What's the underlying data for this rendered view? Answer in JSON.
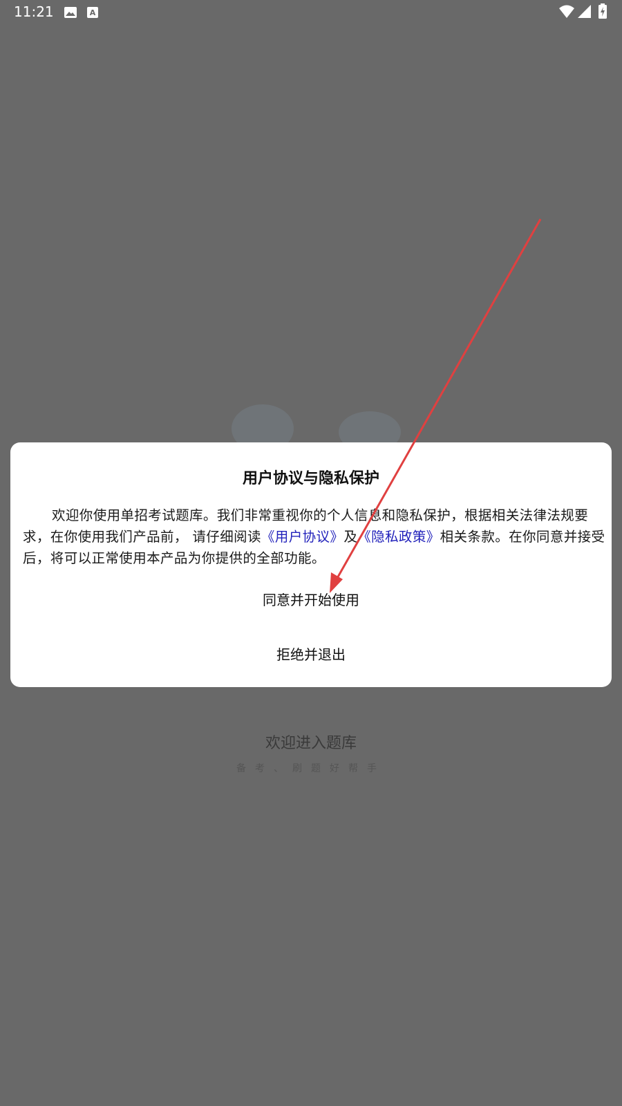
{
  "status_bar": {
    "time": "11:21",
    "icons": [
      "image-icon",
      "font-icon",
      "wifi-icon",
      "signal-icon",
      "battery-icon"
    ]
  },
  "dialog": {
    "title": "用户协议与隐私保护",
    "body_prefix": "欢迎你使用单招考试题库。我们非常重视你的个人信息和隐私保护，根据相关法律法规要求，在你使用我们产品前， 请仔细阅读",
    "user_agreement_link": "《用户协议》",
    "connector": "及",
    "privacy_policy_link": "《隐私政策》",
    "body_suffix": "相关条款。在你同意并接受后，将可以正常使用本产品为你提供的全部功能。",
    "agree_button": "同意并开始使用",
    "reject_button": "拒绝并退出"
  },
  "background": {
    "welcome_title": "欢迎进入题库",
    "welcome_subtitle": "备考、刷题好帮手"
  },
  "colors": {
    "overlay": "#696969",
    "link": "#2222bb",
    "annotation_arrow": "#e04040"
  }
}
